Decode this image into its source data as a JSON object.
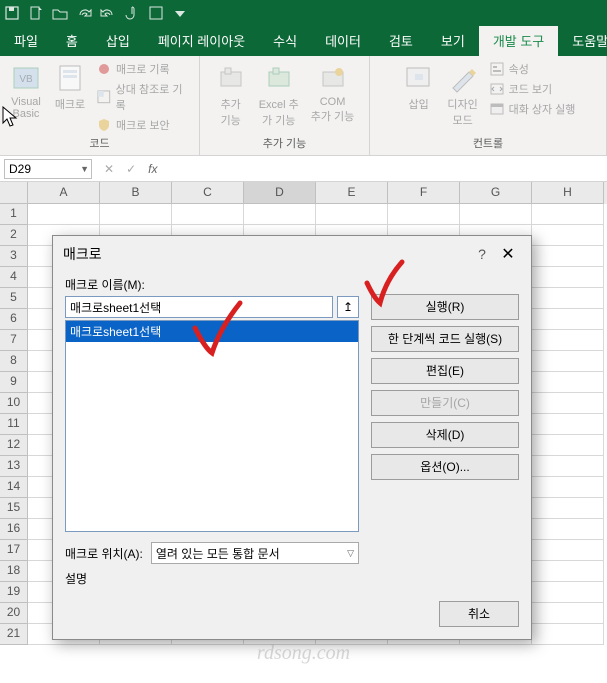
{
  "qat": {
    "icons": [
      "save",
      "new",
      "open",
      "redo",
      "undo",
      "touch",
      "save2",
      "more"
    ]
  },
  "tabs": {
    "items": [
      {
        "label": "파일"
      },
      {
        "label": "홈"
      },
      {
        "label": "삽입"
      },
      {
        "label": "페이지 레이아웃"
      },
      {
        "label": "수식"
      },
      {
        "label": "데이터"
      },
      {
        "label": "검토"
      },
      {
        "label": "보기"
      },
      {
        "label": "개발 도구"
      },
      {
        "label": "도움말"
      }
    ],
    "active": 8
  },
  "ribbon": {
    "code": {
      "title": "코드",
      "vb": "Visual\nBasic",
      "macro": "매크로",
      "record": "매크로 기록",
      "relref": "상대 참조로 기록",
      "security": "매크로 보안"
    },
    "addins": {
      "title": "추가 기능",
      "addin": "추가\n기능",
      "excel": "Excel 추\n가 기능",
      "com": "COM\n추가 기능"
    },
    "controls": {
      "title": "컨트롤",
      "insert": "삽입",
      "design": "디자인\n모드",
      "props": "속성",
      "viewcode": "코드 보기",
      "rundlg": "대화 상자 실행"
    }
  },
  "namebox": "D29",
  "formula_fx": "fx",
  "columns": [
    "A",
    "B",
    "C",
    "D",
    "E",
    "F",
    "G",
    "H"
  ],
  "row_count": 21,
  "dialog": {
    "title": "매크로",
    "help": "?",
    "close": "✕",
    "name_label": "매크로 이름(M):",
    "name_value": "매크로sheet1선택",
    "ref_icon": "↥",
    "listitem": "매크로sheet1선택",
    "loc_label": "매크로 위치(A):",
    "loc_value": "열려 있는 모든 통합 문서",
    "desc_label": "설명",
    "buttons": {
      "run": "실행(R)",
      "step": "한 단계씩 코드 실행(S)",
      "edit": "편집(E)",
      "create": "만들기(C)",
      "del": "삭제(D)",
      "options": "옵션(O)..."
    },
    "cancel": "취소"
  },
  "watermark": "rdsong.com"
}
